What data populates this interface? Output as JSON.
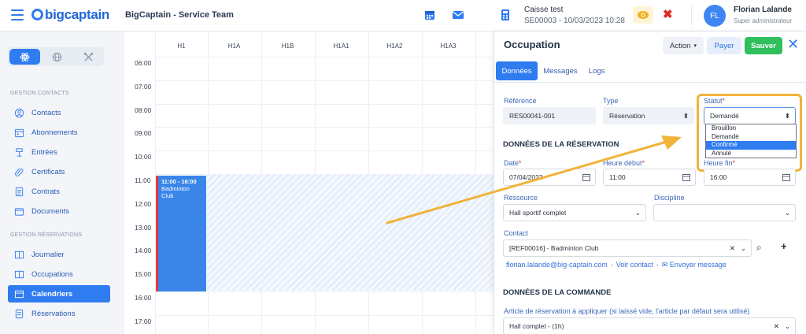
{
  "app": {
    "logo_text": "bigcaptain",
    "title": "BigCaptain - Service Team"
  },
  "topbar": {
    "register_name": "Caisse test",
    "register_meta": "SE00003 - 10/03/2023 10:28",
    "user_initials": "FL",
    "user_name": "Florian Lalande",
    "user_role": "Super administrateur"
  },
  "sidebar": {
    "section_contacts": "GESTION CONTACTS",
    "section_reservations": "GESTION RÉSERVATIONS",
    "contacts_items": [
      "Contacts",
      "Abonnements",
      "Entrées",
      "Certificats",
      "Contrats",
      "Documents"
    ],
    "reservation_items": [
      "Journalier",
      "Occupations",
      "Calendriers",
      "Réservations"
    ],
    "active_item": "Calendriers"
  },
  "calendar": {
    "columns": [
      "H1",
      "H1A",
      "H1B",
      "H1A1",
      "H1A2",
      "H1A3"
    ],
    "hours": [
      "06:00",
      "07:00",
      "08:00",
      "09:00",
      "10:00",
      "11:00",
      "12:00",
      "13:00",
      "14:00",
      "15:00",
      "16:00",
      "17:00"
    ],
    "event": {
      "time": "11:00 - 16:00",
      "name": "Badminton Club"
    }
  },
  "panel": {
    "title": "Occupation",
    "action_label": "Action",
    "payer_label": "Payer",
    "save_label": "Sauver",
    "tabs": [
      "Données",
      "Messages",
      "Logs"
    ],
    "reference_label": "Référence",
    "reference_value": "RES00041-001",
    "type_label": "Type",
    "type_value": "Réservation",
    "statut_label": "Statut",
    "statut_value": "Demandé",
    "statut_options": [
      "Brouillon",
      "Demandé",
      "Confirmé",
      "Annulé"
    ],
    "statut_selected": "Confirmé",
    "section_reservation": "DONNÉES DE LA RÉSERVATION",
    "date_label": "Date",
    "date_value": "07/04/2023",
    "heure_debut_label": "Heure début",
    "heure_debut_value": "11:00",
    "heure_fin_label": "Heure fin",
    "heure_fin_value": "16:00",
    "ressource_label": "Ressource",
    "ressource_value": "Hall sportif complet",
    "discipline_label": "Discipline",
    "discipline_value": "",
    "contact_label": "Contact",
    "contact_value": "[REF00016] - Badminton Club",
    "contact_email": "florian.lalande@big-captain.com",
    "voir_contact": "Voir contact",
    "envoyer_message": "Envoyer message",
    "section_commande": "DONNÉES DE LA COMMANDE",
    "article_label": "Article de réservation à appliquer (si laissé vide, l'article par défaut sera utilisé)",
    "article_value": "Hall complet - (1h)"
  },
  "colors": {
    "primary": "#2f7bf0",
    "save": "#2fbf5c",
    "annotation": "#f1b33a",
    "event_border": "#e23a3a"
  }
}
